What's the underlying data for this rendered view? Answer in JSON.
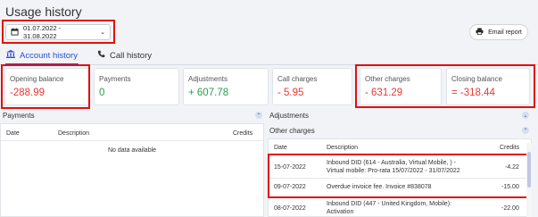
{
  "header": {
    "title": "Usage history",
    "email_label": "Email report"
  },
  "date_range": {
    "value": "01.07.2022 - 31.08.2022"
  },
  "tabs": [
    {
      "label": "Account history"
    },
    {
      "label": "Call history"
    }
  ],
  "cards": [
    {
      "label": "Opening balance",
      "value": "-288.99"
    },
    {
      "label": "Payments",
      "value": "0"
    },
    {
      "label": "Adjustments",
      "value": "+ 607.78"
    },
    {
      "label": "Call charges",
      "value": "- 5.95"
    },
    {
      "label": "Other charges",
      "value": "- 631.29"
    },
    {
      "label": "Closing balance",
      "value": "= -318.44"
    }
  ],
  "payments": {
    "title": "Payments",
    "columns": [
      "Date",
      "Description",
      "Credits"
    ],
    "empty": "No data available"
  },
  "adjustments": {
    "title": "Adjustments"
  },
  "other_charges": {
    "title": "Other charges",
    "columns": [
      "Date",
      "Description",
      "Credits"
    ],
    "rows": [
      {
        "date": "15-07-2022",
        "desc1": "Inbound DID (614 - Australia, Virtual Mobile, ) -",
        "desc2": "Virtual mobile: Pro-rata 15/07/2022 - 31/07/2022",
        "credits": "-4.22"
      },
      {
        "date": "09-07-2022",
        "desc1": "Overdue invoice fee. Invoice #838078",
        "desc2": "",
        "credits": "-15.00"
      },
      {
        "date": "08-07-2022",
        "desc1": "Inbound DID (447 - United Kingdom, Mobile):",
        "desc2": "Activation",
        "credits": "-22.00"
      }
    ]
  },
  "colors": {
    "accent": "#2b4fd6",
    "negative": "#e53935",
    "positive": "#2e9e4f",
    "highlight": "#e01010"
  }
}
